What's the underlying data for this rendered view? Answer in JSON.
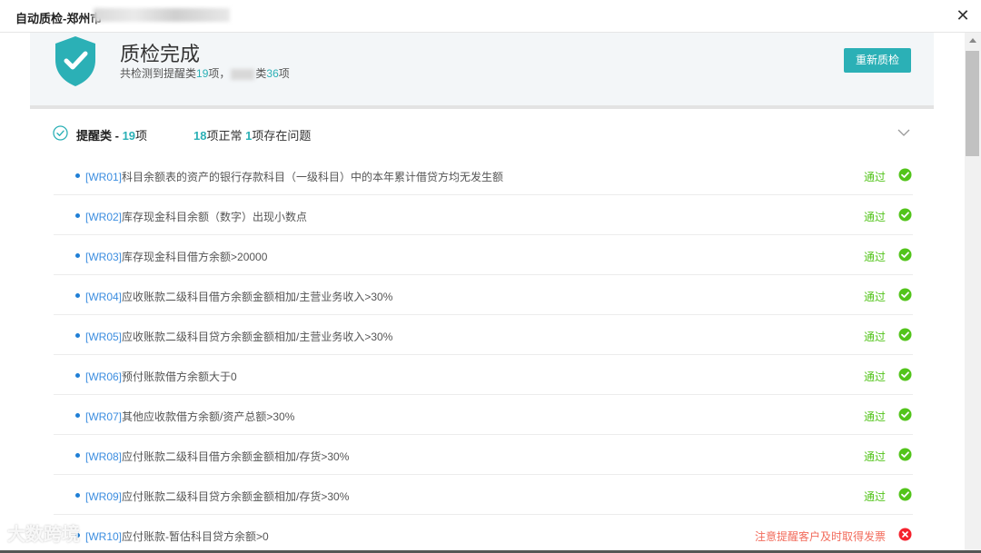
{
  "window": {
    "title": "自动质检-郑州市"
  },
  "header": {
    "done_title": "质检完成",
    "summary_prefix": "共检测到提醒类",
    "remind_count": "19",
    "summary_mid": "项，",
    "summary_cat_suffix": "类",
    "other_count": "36",
    "summary_end": "项",
    "recheck_label": "重新质检"
  },
  "section": {
    "label": "提醒类 - ",
    "count": "19",
    "unit": "项",
    "normal_count": "18",
    "normal_label": "项正常 ",
    "issue_count": "1",
    "issue_label": "项存在问题"
  },
  "rows": [
    {
      "code": "[WR01]",
      "desc": "科目余额表的资产的银行存款科目（一级科目）中的本年累计借贷方均无发生额",
      "status": "通过",
      "kind": "pass"
    },
    {
      "code": "[WR02]",
      "desc": "库存现金科目余额（数字）出现小数点",
      "status": "通过",
      "kind": "pass"
    },
    {
      "code": "[WR03]",
      "desc": "库存现金科目借方余额>20000",
      "status": "通过",
      "kind": "pass"
    },
    {
      "code": "[WR04]",
      "desc": "应收账款二级科目借方余额金额相加/主营业务收入>30%",
      "status": "通过",
      "kind": "pass"
    },
    {
      "code": "[WR05]",
      "desc": "应收账款二级科目贷方余额金额相加/主营业务收入>30%",
      "status": "通过",
      "kind": "pass"
    },
    {
      "code": "[WR06]",
      "desc": "预付账款借方余额大于0",
      "status": "通过",
      "kind": "pass"
    },
    {
      "code": "[WR07]",
      "desc": "其他应收款借方余额/资产总额>30%",
      "status": "通过",
      "kind": "pass"
    },
    {
      "code": "[WR08]",
      "desc": "应付账款二级科目借方余额金额相加/存货>30%",
      "status": "通过",
      "kind": "pass"
    },
    {
      "code": "[WR09]",
      "desc": "应付账款二级科目贷方余额金额相加/存货>30%",
      "status": "通过",
      "kind": "pass"
    },
    {
      "code": "[WR10]",
      "desc": "应付账款-暂估科目贷方余额>0",
      "status": "注意提醒客户及时取得发票",
      "kind": "warn"
    }
  ],
  "watermark": "大数跨境",
  "colors": {
    "accent": "#2bb0b6",
    "pass": "#52c41a",
    "warn": "#f26b5b",
    "code": "#3b8de0"
  },
  "icons": {
    "shield": "shield-check-icon",
    "section": "check-circle-icon",
    "pass": "check-circle-filled-icon",
    "warn": "error-circle-icon",
    "chevron": "chevron-down-icon",
    "close": "close-icon"
  }
}
